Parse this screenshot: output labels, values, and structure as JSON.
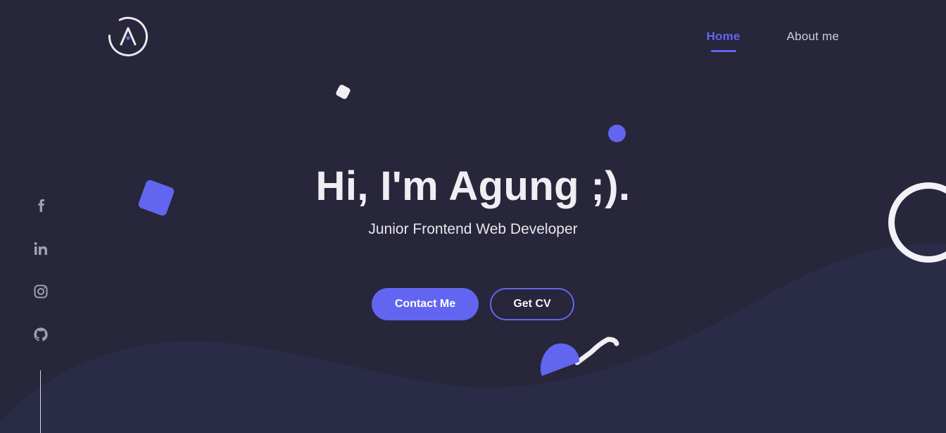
{
  "header": {
    "logo_icon": "logo-circle-a-icon",
    "nav": [
      {
        "label": "Home",
        "active": true
      },
      {
        "label": "About me",
        "active": false
      }
    ]
  },
  "hero": {
    "title": "Hi, I'm Agung ;).",
    "subtitle": "Junior Frontend Web Developer",
    "primary_button": "Contact Me",
    "secondary_button": "Get CV"
  },
  "social": {
    "icons": [
      "facebook-icon",
      "linkedin-icon",
      "instagram-icon",
      "github-icon"
    ]
  },
  "theme": {
    "background": "#27263a",
    "wave": "#2a2b47",
    "accent": "#6265ef",
    "text": "#efeff3",
    "icon": "#9da0ad"
  }
}
